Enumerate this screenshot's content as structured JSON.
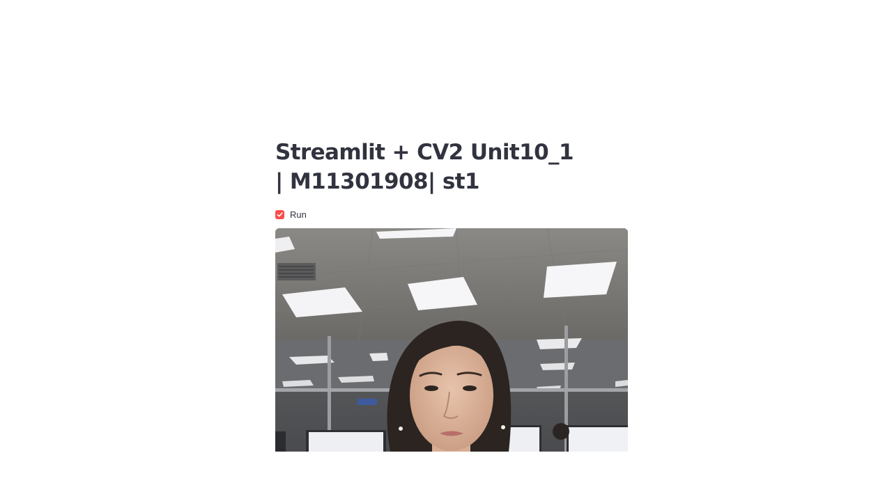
{
  "header": {
    "title": "Streamlit + CV2 Unit10_1 | M11301908| st1"
  },
  "controls": {
    "run_checkbox": {
      "label": "Run",
      "checked": true
    }
  },
  "video": {
    "description_alt": "Webcam frame"
  },
  "colors": {
    "accent": "#ff4b4b",
    "text": "#31333f",
    "background": "#ffffff"
  },
  "icons": {
    "checkbox": "check-icon"
  }
}
